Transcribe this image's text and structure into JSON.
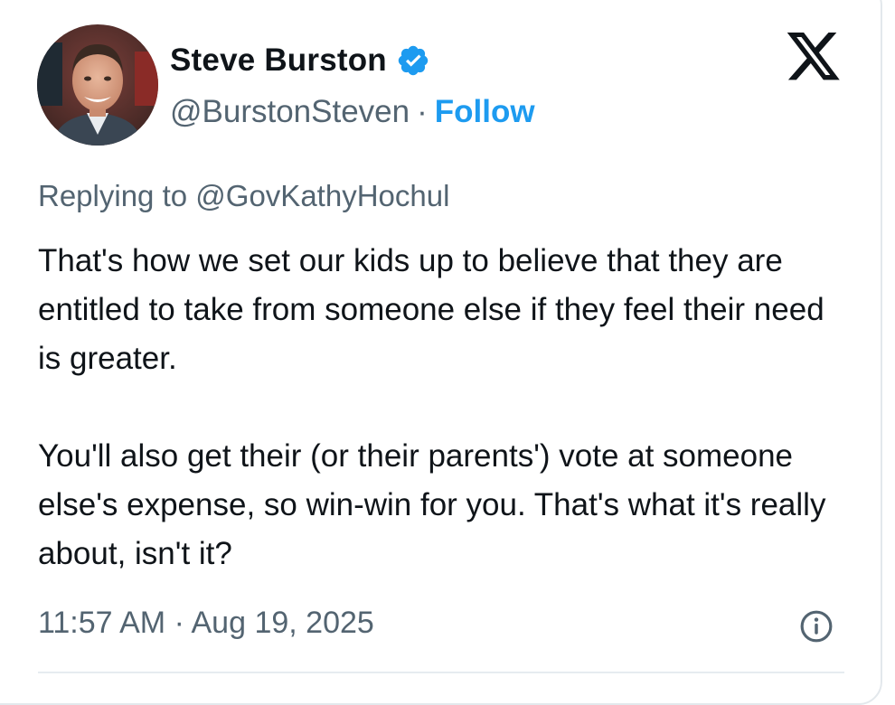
{
  "author": {
    "name": "Steve Burston",
    "handle": "@BurstonSteven",
    "separator": "·",
    "follow_label": "Follow"
  },
  "icons": {
    "verified": "verified-badge-icon",
    "logo": "x-logo-icon",
    "info": "info-icon"
  },
  "colors": {
    "accent": "#1d9bf0",
    "text_primary": "#0f1419",
    "text_secondary": "#536471"
  },
  "reply": {
    "prefix": "Replying to",
    "mention": "@GovKathyHochul"
  },
  "tweet": {
    "paragraph_1": "That's how we set our kids up to believe that they are entitled to take from someone else if they feel their need is greater.",
    "paragraph_2": "You'll also get their (or their parents') vote at someone else's expense, so win-win for you. That's what it's really about, isn't it?"
  },
  "meta": {
    "time": "11:57 AM",
    "separator": "·",
    "date": "Aug 19, 2025"
  }
}
